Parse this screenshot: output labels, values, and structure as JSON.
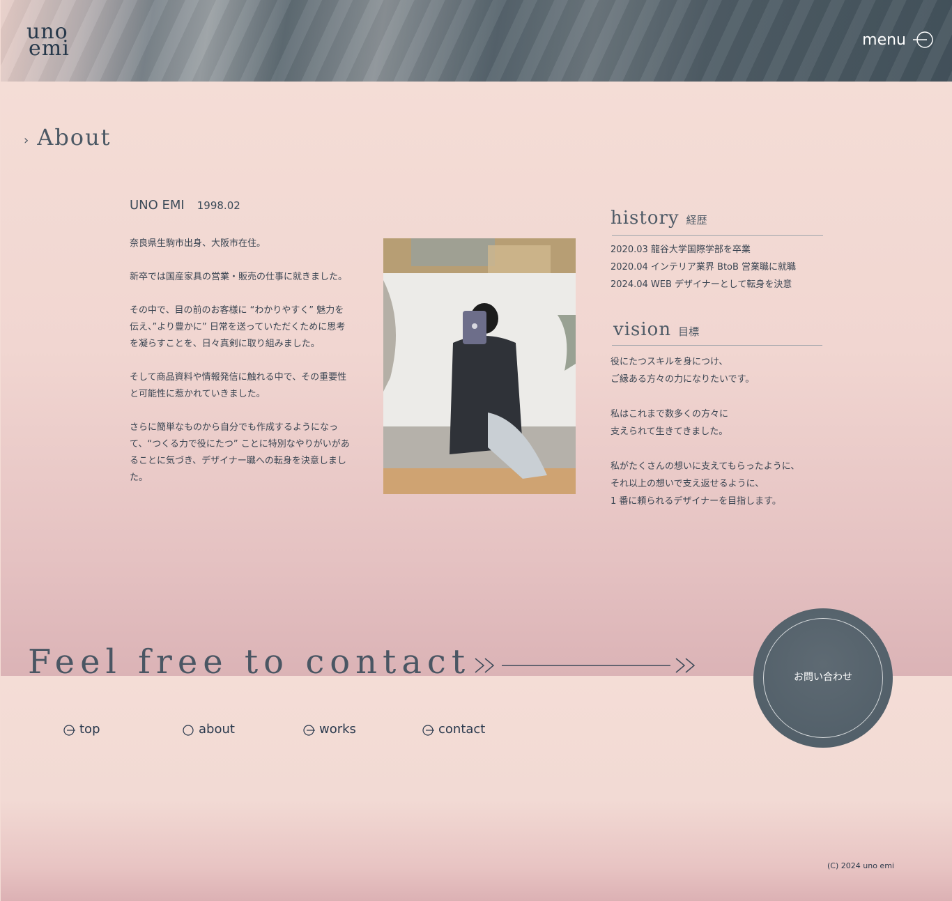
{
  "header": {
    "logo_line1": "uno",
    "logo_line2": "emi",
    "menu_label": "menu"
  },
  "about": {
    "section_title": "About",
    "name": "UNO EMI",
    "birth": "1998.02",
    "bio": [
      "奈良県生駒市出身、大阪市在住。",
      "新卒では国産家具の営業・販売の仕事に就きました。",
      "その中で、目の前のお客様に “わかりやすく” 魅力を伝え、”より豊かに” 日常を送っていただくために思考を凝らすことを、日々真剣に取り組みました。",
      "そして商品資料や情報発信に触れる中で、その重要性と可能性に惹かれていきました。",
      "さらに簡単なものから自分でも作成するようになって、“つくる力で役にたつ” ことに特別なやりがいがあることに気づき、デザイナー職への転身を決意しました。"
    ],
    "history_title_en": "history",
    "history_title_ja": "経歴",
    "history": [
      "2020.03 龍谷大学国際学部を卒業",
      "2020.04 インテリア業界 BtoB 営業職に就職",
      "2024.04 WEB デザイナーとして転身を決意"
    ],
    "vision_title_en": "vision",
    "vision_title_ja": "目標",
    "vision": [
      [
        "役にたつスキルを身につけ、",
        "ご縁ある方々の力になりたいです。"
      ],
      [
        "私はこれまで数多くの方々に",
        "支えられて生きてきました。"
      ],
      [
        "私がたくさんの想いに支えてもらったように、",
        "それ以上の想いで支え返せるように、",
        "1 番に頼られるデザイナーを目指します。"
      ]
    ]
  },
  "contact": {
    "heading": "Feel free to contact",
    "button_label": "お問い合わせ"
  },
  "footer": {
    "nav": [
      "top",
      "about",
      "works",
      "contact"
    ],
    "copyright": "(C) 2024 uno emi"
  },
  "colors": {
    "accent": "#4e5c66",
    "text": "#3a4552",
    "background": "#f4ddd6"
  }
}
